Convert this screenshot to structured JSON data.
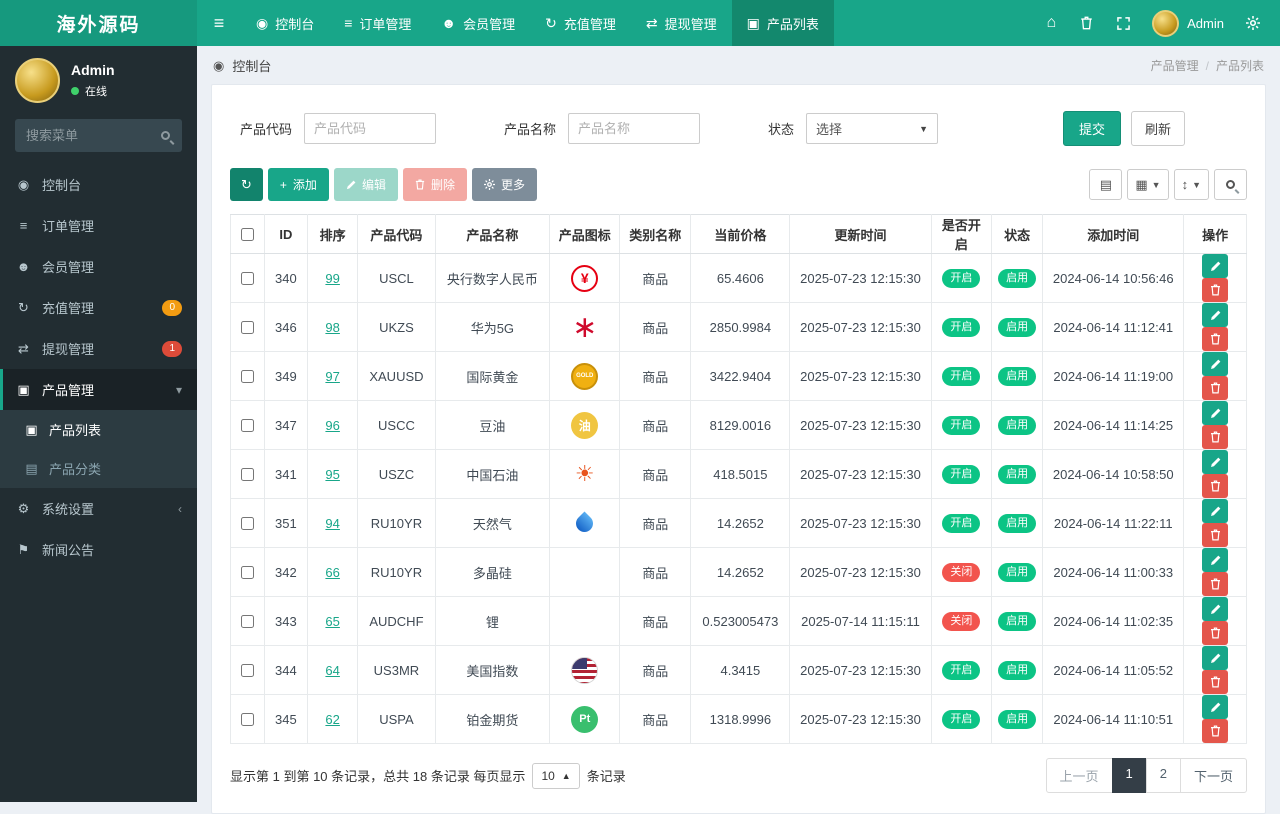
{
  "navbar": {
    "brand": "海外源码",
    "items": [
      {
        "label": "控制台",
        "icon": "dashboard",
        "active": false
      },
      {
        "label": "订单管理",
        "icon": "orders",
        "active": false
      },
      {
        "label": "会员管理",
        "icon": "members",
        "active": false
      },
      {
        "label": "充值管理",
        "icon": "recharge",
        "active": false
      },
      {
        "label": "提现管理",
        "icon": "withdraw",
        "active": false
      },
      {
        "label": "产品列表",
        "icon": "products",
        "active": true
      }
    ],
    "user": "Admin"
  },
  "sidebar": {
    "user_name": "Admin",
    "user_status": "在线",
    "search_placeholder": "搜索菜单",
    "menu": [
      {
        "label": "控制台",
        "icon": "dashboard"
      },
      {
        "label": "订单管理",
        "icon": "orders"
      },
      {
        "label": "会员管理",
        "icon": "members"
      },
      {
        "label": "充值管理",
        "icon": "recharge",
        "badge": "0",
        "badge_color": "#f39c12"
      },
      {
        "label": "提现管理",
        "icon": "withdraw",
        "badge": "1",
        "badge_color": "#dd4b39"
      },
      {
        "label": "产品管理",
        "icon": "products",
        "active": true,
        "chevron": "down",
        "children": [
          {
            "label": "产品列表",
            "icon": "products",
            "active": true
          },
          {
            "label": "产品分类",
            "icon": "category"
          }
        ]
      },
      {
        "label": "系统设置",
        "icon": "settings",
        "chevron": "left"
      },
      {
        "label": "新闻公告",
        "icon": "news"
      }
    ]
  },
  "breadcrumb": {
    "left": "控制台",
    "parent": "产品管理",
    "current": "产品列表"
  },
  "filters": {
    "code_label": "产品代码",
    "code_placeholder": "产品代码",
    "name_label": "产品名称",
    "name_placeholder": "产品名称",
    "status_label": "状态",
    "status_value": "选择",
    "submit": "提交",
    "refresh": "刷新"
  },
  "toolbar": {
    "add": "添加",
    "edit": "编辑",
    "delete": "删除",
    "more": "更多"
  },
  "table": {
    "columns": [
      "ID",
      "排序",
      "产品代码",
      "产品名称",
      "产品图标",
      "类别名称",
      "当前价格",
      "更新时间",
      "是否开启",
      "状态",
      "添加时间",
      "操作"
    ],
    "rows": [
      {
        "id": "340",
        "sort": "99",
        "code": "USCL",
        "name": "央行数字人民币",
        "icon": {
          "kind": "ring",
          "glyph": "¥",
          "color": "#e60012",
          "name": "cny-icon"
        },
        "category": "商品",
        "price": "65.4606",
        "updated": "2025-07-23 12:15:30",
        "open": "开启",
        "open_on": true,
        "status": "启用",
        "added": "2024-06-14 10:56:46"
      },
      {
        "id": "346",
        "sort": "98",
        "code": "UKZS",
        "name": "华为5G",
        "icon": {
          "kind": "glyph",
          "glyph": "∗",
          "color": "#cf0a2c",
          "size": "30px",
          "name": "huawei-icon"
        },
        "category": "商品",
        "price": "2850.9984",
        "updated": "2025-07-23 12:15:30",
        "open": "开启",
        "open_on": true,
        "status": "启用",
        "added": "2024-06-14 11:12:41"
      },
      {
        "id": "349",
        "sort": "97",
        "code": "XAUUSD",
        "name": "国际黄金",
        "icon": {
          "kind": "coin",
          "text": "GOLD",
          "bg": "#f0b011",
          "border": "#c8900a",
          "color": "#fff",
          "size": "6px",
          "name": "gold-icon"
        },
        "category": "商品",
        "price": "3422.9404",
        "updated": "2025-07-23 12:15:30",
        "open": "开启",
        "open_on": true,
        "status": "启用",
        "added": "2024-06-14 11:19:00"
      },
      {
        "id": "347",
        "sort": "96",
        "code": "USCC",
        "name": "豆油",
        "icon": {
          "kind": "solid",
          "text": "油",
          "bg": "#f0c541",
          "color": "#fff",
          "size": "12px",
          "name": "soybean-oil-icon"
        },
        "category": "商品",
        "price": "8129.0016",
        "updated": "2025-07-23 12:15:30",
        "open": "开启",
        "open_on": true,
        "status": "启用",
        "added": "2024-06-14 11:14:25"
      },
      {
        "id": "341",
        "sort": "95",
        "code": "USZC",
        "name": "中国石油",
        "icon": {
          "kind": "glyph",
          "glyph": "☀",
          "color": "#e8541e",
          "size": "22px",
          "name": "petrochina-icon"
        },
        "category": "商品",
        "price": "418.5015",
        "updated": "2025-07-23 12:15:30",
        "open": "开启",
        "open_on": true,
        "status": "启用",
        "added": "2024-06-14 10:58:50"
      },
      {
        "id": "351",
        "sort": "94",
        "code": "RU10YR",
        "name": "天然气",
        "icon": {
          "kind": "drop",
          "color1": "#5ab0f2",
          "color2": "#1663c7",
          "name": "gas-icon"
        },
        "category": "商品",
        "price": "14.2652",
        "updated": "2025-07-23 12:15:30",
        "open": "开启",
        "open_on": true,
        "status": "启用",
        "added": "2024-06-14 11:22:11"
      },
      {
        "id": "342",
        "sort": "66",
        "code": "RU10YR",
        "name": "多晶硅",
        "icon": {
          "kind": "none"
        },
        "category": "商品",
        "price": "14.2652",
        "updated": "2025-07-23 12:15:30",
        "open": "关闭",
        "open_on": false,
        "status": "启用",
        "added": "2024-06-14 11:00:33"
      },
      {
        "id": "343",
        "sort": "65",
        "code": "AUDCHF",
        "name": "锂",
        "icon": {
          "kind": "none"
        },
        "category": "商品",
        "price": "0.523005473",
        "updated": "2025-07-14 11:15:11",
        "open": "关闭",
        "open_on": false,
        "status": "启用",
        "added": "2024-06-14 11:02:35"
      },
      {
        "id": "344",
        "sort": "64",
        "code": "US3MR",
        "name": "美国指数",
        "icon": {
          "kind": "flag-us",
          "name": "us-flag-icon"
        },
        "category": "商品",
        "price": "4.3415",
        "updated": "2025-07-23 12:15:30",
        "open": "开启",
        "open_on": true,
        "status": "启用",
        "added": "2024-06-14 11:05:52"
      },
      {
        "id": "345",
        "sort": "62",
        "code": "USPA",
        "name": "铂金期货",
        "icon": {
          "kind": "solid",
          "text": "Pt",
          "bg": "#39bf6e",
          "color": "#fff",
          "size": "11px",
          "name": "platinum-icon"
        },
        "category": "商品",
        "price": "1318.9996",
        "updated": "2025-07-23 12:15:30",
        "open": "开启",
        "open_on": true,
        "status": "启用",
        "added": "2024-06-14 11:10:51"
      }
    ]
  },
  "pagination": {
    "info": "显示第 1 到第 10 条记录，总共 18 条记录 每页显示",
    "page_size": "10",
    "info_suffix": "条记录",
    "prev": "上一页",
    "next": "下一页",
    "pages": [
      "1",
      "2"
    ],
    "active_page": "1"
  }
}
